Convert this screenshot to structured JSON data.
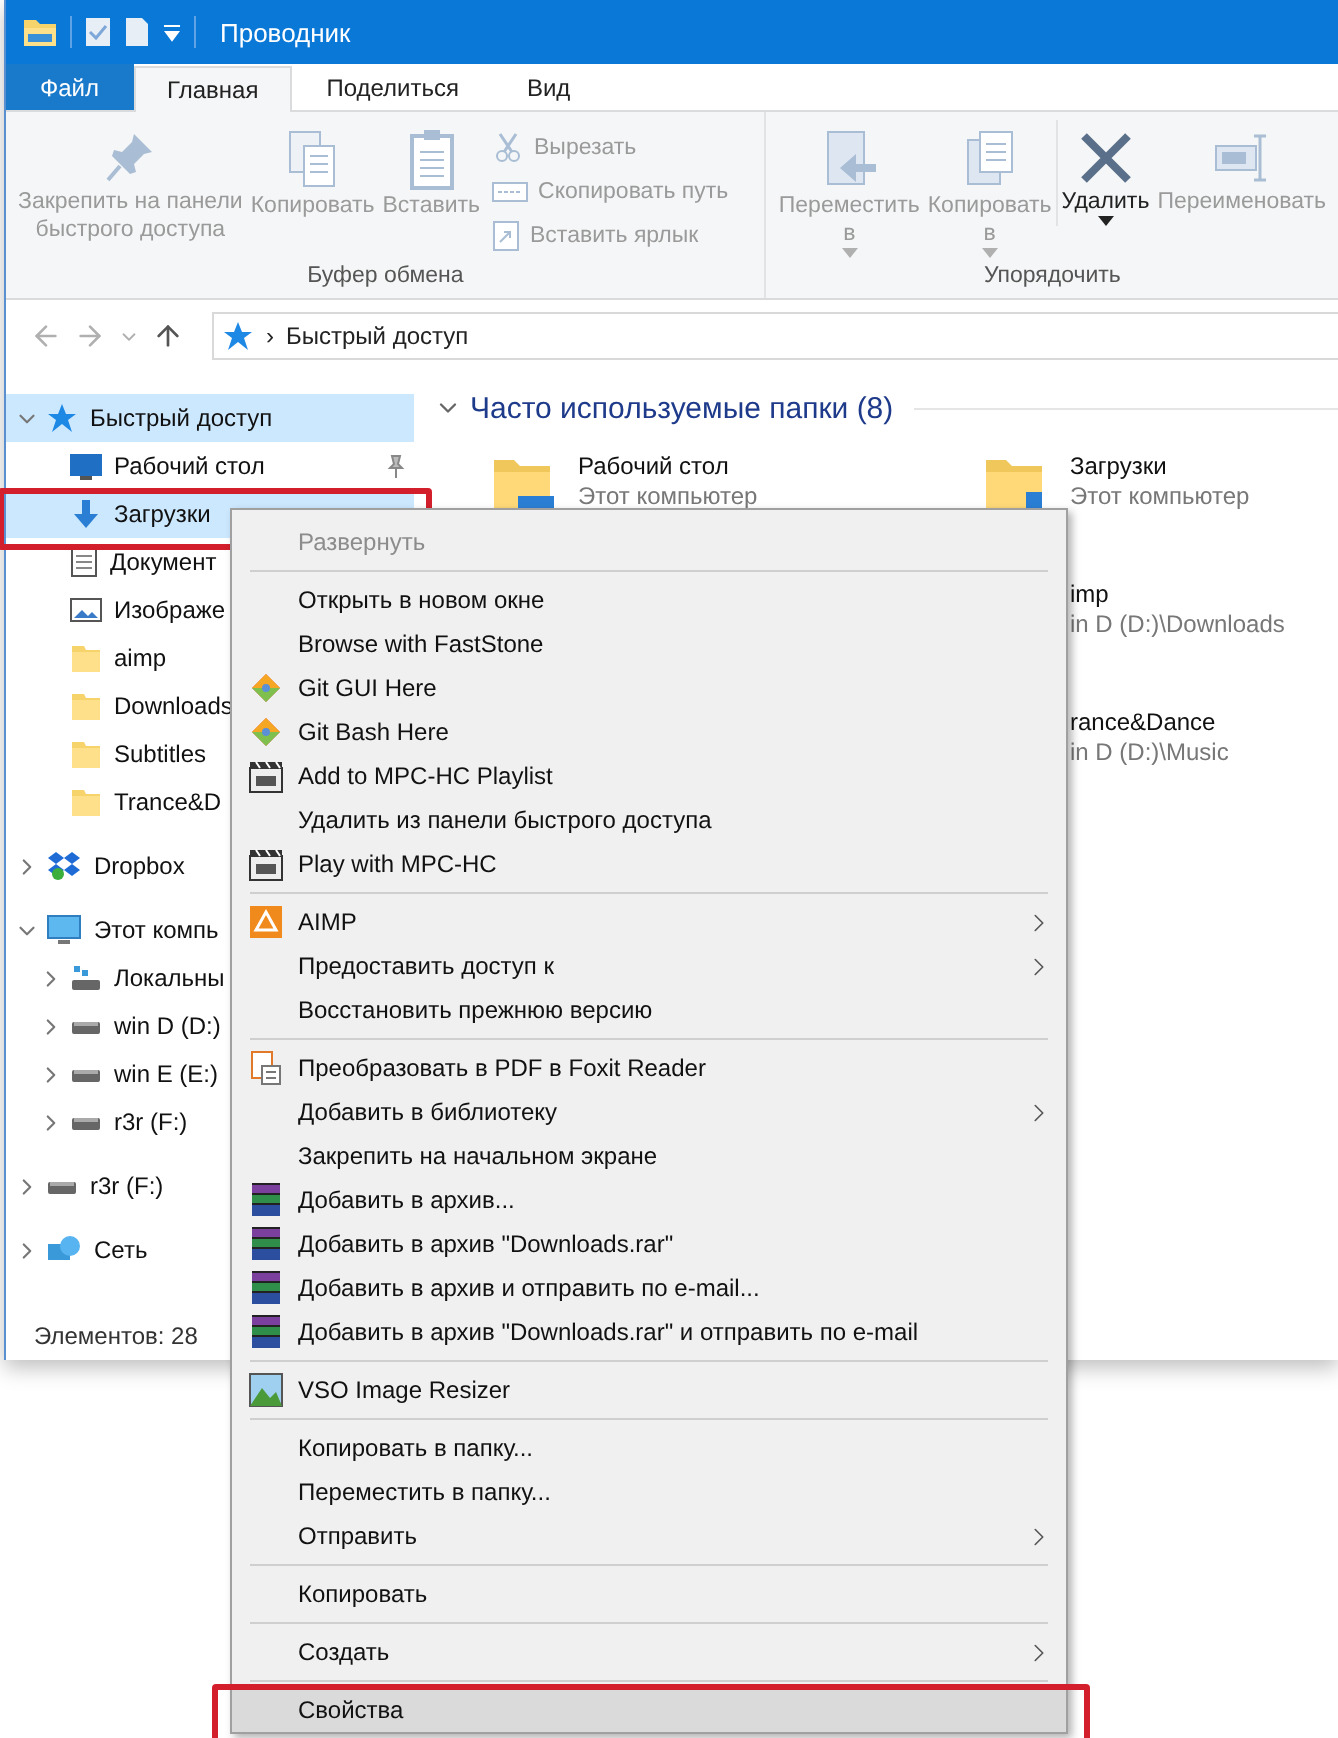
{
  "window": {
    "title": "Проводник"
  },
  "tabs": [
    {
      "label": "Файл",
      "kind": "file",
      "selected": false
    },
    {
      "label": "Главная",
      "kind": "tab",
      "selected": true
    },
    {
      "label": "Поделиться",
      "kind": "tab",
      "selected": false
    },
    {
      "label": "Вид",
      "kind": "tab",
      "selected": false
    }
  ],
  "ribbon": {
    "groups": [
      {
        "label": "Буфер обмена",
        "large": [
          {
            "label": "Закрепить на панели\nбыстрого доступа",
            "disabled": true,
            "dropdown": false
          },
          {
            "label": "Копировать",
            "disabled": true,
            "dropdown": false
          },
          {
            "label": "Вставить",
            "disabled": true,
            "dropdown": false
          }
        ],
        "small": [
          {
            "label": "Вырезать",
            "disabled": true
          },
          {
            "label": "Скопировать путь",
            "disabled": true
          },
          {
            "label": "Вставить ярлык",
            "disabled": true
          }
        ]
      },
      {
        "label": "Упорядочить",
        "large": [
          {
            "label": "Переместить\nв",
            "disabled": true,
            "dropdown": true
          },
          {
            "label": "Копировать\nв",
            "disabled": true,
            "dropdown": true
          },
          {
            "label": "Удалить",
            "disabled": false,
            "dropdown": true,
            "divider": true
          },
          {
            "label": "Переименовать",
            "disabled": true,
            "dropdown": false
          }
        ]
      }
    ]
  },
  "address": {
    "path": "Быстрый доступ",
    "separator": "›"
  },
  "navigation": [
    {
      "label": "Быстрый доступ",
      "kind": "star",
      "expanded": true,
      "selected": true,
      "children": [
        {
          "label": "Рабочий стол",
          "kind": "desktop",
          "selected": false,
          "pinned": true
        },
        {
          "label": "Загрузки",
          "kind": "download",
          "selected": true,
          "annotated": true
        },
        {
          "label": "Документ",
          "kind": "document",
          "selected": false
        },
        {
          "label": "Изображе",
          "kind": "image",
          "selected": false
        },
        {
          "label": "aimp",
          "kind": "folder",
          "selected": false
        },
        {
          "label": "Downloads",
          "kind": "folder",
          "selected": false
        },
        {
          "label": "Subtitles",
          "kind": "folder",
          "selected": false
        },
        {
          "label": "Trance&D",
          "kind": "folder",
          "selected": false
        }
      ]
    },
    {
      "label": "Dropbox",
      "kind": "dropbox",
      "expanded": false,
      "selected": false
    },
    {
      "label": "Этот компь",
      "kind": "computer",
      "expanded": true,
      "selected": false,
      "children": [
        {
          "label": "Локальны",
          "kind": "netdrive",
          "expanded": false,
          "selected": false
        },
        {
          "label": "win D (D:)",
          "kind": "drive",
          "expanded": false,
          "selected": false
        },
        {
          "label": "win E (E:)",
          "kind": "drive",
          "expanded": false,
          "selected": false
        },
        {
          "label": "r3r (F:)",
          "kind": "drive",
          "expanded": false,
          "selected": false
        }
      ]
    },
    {
      "label": "r3r (F:)",
      "kind": "drive",
      "expanded": false,
      "selected": false
    },
    {
      "label": "Сеть",
      "kind": "network",
      "expanded": false,
      "selected": false
    }
  ],
  "status_bar": {
    "text": "Элементов: 28"
  },
  "frequent": {
    "title": "Часто используемые папки (8)",
    "expanded": true,
    "tiles": [
      {
        "name": "Рабочий стол",
        "location": "Этот компьютер",
        "kind": "desktop"
      },
      {
        "name": "Загрузки",
        "location": "Этот компьютер",
        "kind": "download"
      },
      {
        "name": "imp",
        "location": "in D (D:)\\Downloads",
        "kind": "covered"
      },
      {
        "name": "rance&Dance",
        "location": "in D (D:)\\Music",
        "kind": "covered"
      }
    ]
  },
  "context_menu": [
    {
      "kind": "plain",
      "label": "Развернуть",
      "disabled": true,
      "submenu": false,
      "selected": false
    },
    {
      "kind": "separator"
    },
    {
      "kind": "plain",
      "label": "Открыть в новом окне",
      "disabled": false,
      "submenu": false,
      "selected": false
    },
    {
      "kind": "plain",
      "label": "Browse with FastStone",
      "disabled": false,
      "submenu": false,
      "selected": false
    },
    {
      "kind": "git",
      "label": "Git GUI Here",
      "disabled": false,
      "submenu": false,
      "selected": false
    },
    {
      "kind": "git",
      "label": "Git Bash Here",
      "disabled": false,
      "submenu": false,
      "selected": false
    },
    {
      "kind": "player",
      "label": "Add to MPC-HC Playlist",
      "disabled": false,
      "submenu": false,
      "selected": false
    },
    {
      "kind": "plain",
      "label": "Удалить из панели быстрого доступа",
      "disabled": false,
      "submenu": false,
      "selected": false
    },
    {
      "kind": "player",
      "label": "Play with MPC-HC",
      "disabled": false,
      "submenu": false,
      "selected": false
    },
    {
      "kind": "separator"
    },
    {
      "kind": "aimp",
      "label": "AIMP",
      "disabled": false,
      "submenu": true,
      "selected": false
    },
    {
      "kind": "plain",
      "label": "Предоставить доступ к",
      "disabled": false,
      "submenu": true,
      "selected": false
    },
    {
      "kind": "plain",
      "label": "Восстановить прежнюю версию",
      "disabled": false,
      "submenu": false,
      "selected": false
    },
    {
      "kind": "separator"
    },
    {
      "kind": "pdf",
      "label": "Преобразовать в PDF в Foxit Reader",
      "disabled": false,
      "submenu": false,
      "selected": false
    },
    {
      "kind": "plain",
      "label": "Добавить в библиотеку",
      "disabled": false,
      "submenu": true,
      "selected": false
    },
    {
      "kind": "plain",
      "label": "Закрепить на начальном экране",
      "disabled": false,
      "submenu": false,
      "selected": false
    },
    {
      "kind": "archive",
      "label": "Добавить в архив...",
      "disabled": false,
      "submenu": false,
      "selected": false
    },
    {
      "kind": "archive",
      "label": "Добавить в архив \"Downloads.rar\"",
      "disabled": false,
      "submenu": false,
      "selected": false
    },
    {
      "kind": "archive",
      "label": "Добавить в архив и отправить по e-mail...",
      "disabled": false,
      "submenu": false,
      "selected": false
    },
    {
      "kind": "archive",
      "label": "Добавить в архив \"Downloads.rar\" и отправить по e-mail",
      "disabled": false,
      "submenu": false,
      "selected": false
    },
    {
      "kind": "separator"
    },
    {
      "kind": "resizer",
      "label": "VSO Image Resizer",
      "disabled": false,
      "submenu": false,
      "selected": false
    },
    {
      "kind": "separator"
    },
    {
      "kind": "plain",
      "label": "Копировать в папку...",
      "disabled": false,
      "submenu": false,
      "selected": false
    },
    {
      "kind": "plain",
      "label": "Переместить в папку...",
      "disabled": false,
      "submenu": false,
      "selected": false
    },
    {
      "kind": "plain",
      "label": "Отправить",
      "disabled": false,
      "submenu": true,
      "selected": false
    },
    {
      "kind": "separator"
    },
    {
      "kind": "plain",
      "label": "Копировать",
      "disabled": false,
      "submenu": false,
      "selected": false
    },
    {
      "kind": "separator"
    },
    {
      "kind": "plain",
      "label": "Создать",
      "disabled": false,
      "submenu": true,
      "selected": false
    },
    {
      "kind": "separator"
    },
    {
      "kind": "plain",
      "label": "Свойства",
      "disabled": false,
      "submenu": false,
      "selected": true,
      "annotated": true
    }
  ]
}
